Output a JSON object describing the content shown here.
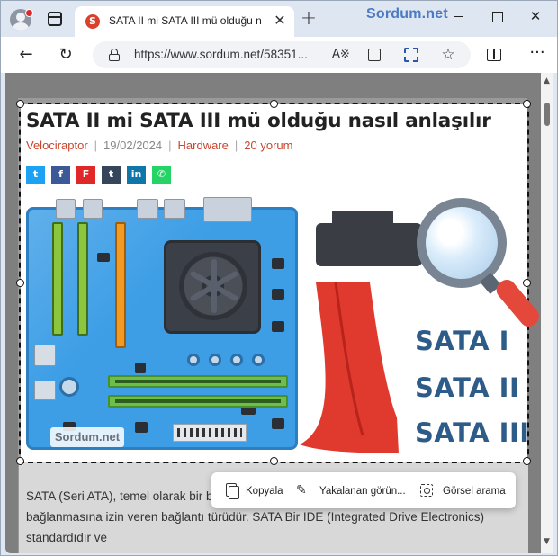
{
  "browser": {
    "tab_title": "SATA II mi SATA III mü olduğu na",
    "watermark": "Sordum.net",
    "url": "https://www.sordum.net/58351...",
    "new_tab_symbol": "+",
    "close_symbol": "✕"
  },
  "article": {
    "title": "SATA II mi SATA III mü olduğu nasıl anlaşılır",
    "author": "Velociraptor",
    "date": "19/02/2024",
    "category": "Hardware",
    "comments": "20 yorum",
    "separator": "|",
    "share_buttons": [
      {
        "name": "twitter",
        "glyph": "t",
        "color": "#1da1f2"
      },
      {
        "name": "facebook",
        "glyph": "f",
        "color": "#3b5998"
      },
      {
        "name": "flipboard",
        "glyph": "F",
        "color": "#e12828"
      },
      {
        "name": "tumblr",
        "glyph": "t",
        "color": "#35465c"
      },
      {
        "name": "linkedin",
        "glyph": "in",
        "color": "#0e76a8"
      },
      {
        "name": "whatsapp",
        "glyph": "✆",
        "color": "#25d366"
      }
    ],
    "illustration": {
      "logo_text": "Sordum.net",
      "labels": [
        "SATA I",
        "SATA II",
        "SATA III"
      ]
    },
    "body": "SATA (Seri ATA), temel olarak bir bilgisayardaki depolama cihazlarının anakarta bağlanmasına izin veren bağlantı türüdür. SATA Bir IDE (Integrated Drive Electronics) standardıdır ve"
  },
  "capture_toolbar": {
    "copy_label": "Kopyala",
    "markup_label": "Yakalanan görün...",
    "visual_search_label": "Görsel arama"
  },
  "colors": {
    "accent_red": "#c8452e",
    "selection_border": "#111111",
    "sata_label_blue": "#2e5c88"
  }
}
